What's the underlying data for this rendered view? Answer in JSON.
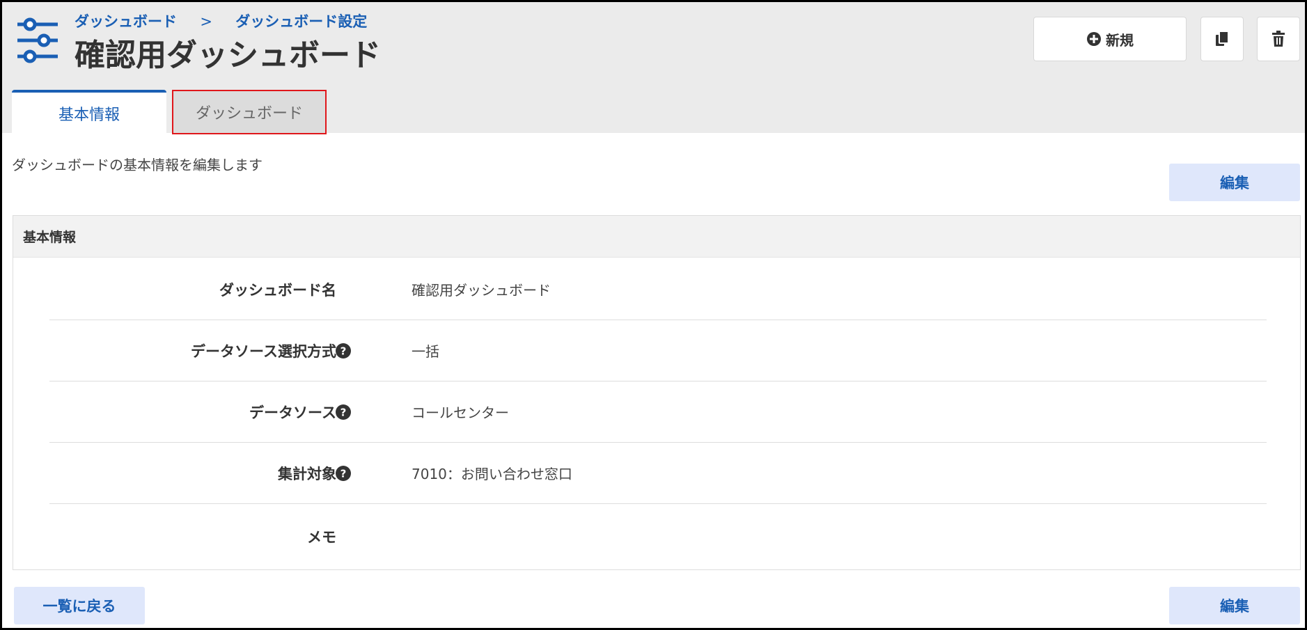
{
  "breadcrumb": {
    "items": [
      "ダッシュボード",
      "ダッシュボード設定"
    ],
    "separator": ">"
  },
  "page": {
    "title": "確認用ダッシュボード",
    "description": "ダッシュボードの基本情報を編集します"
  },
  "toolbar": {
    "new_label": "新規",
    "new_icon": "plus-circle-icon",
    "copy_icon": "copy-icon",
    "delete_icon": "trash-icon"
  },
  "tabs": [
    {
      "label": "基本情報",
      "active": true
    },
    {
      "label": "ダッシュボード",
      "active": false,
      "highlighted": true
    }
  ],
  "buttons": {
    "edit_label": "編集",
    "back_label": "一覧に戻る"
  },
  "panel": {
    "title": "基本情報",
    "rows": [
      {
        "label": "ダッシュボード名",
        "value": "確認用ダッシュボード",
        "help": false
      },
      {
        "label": "データソース選択方式",
        "value": "一括",
        "help": true
      },
      {
        "label": "データソース",
        "value": "コールセンター",
        "help": true
      },
      {
        "label": "集計対象",
        "value": "7010：お問い合わせ窓口",
        "help": true
      },
      {
        "label": "メモ",
        "value": "",
        "help": false
      }
    ]
  },
  "colors": {
    "accent": "#1a5fb4",
    "header_bg": "#ebebeb",
    "button_bg": "#dfe7fb",
    "highlight_border": "#e0161b"
  }
}
